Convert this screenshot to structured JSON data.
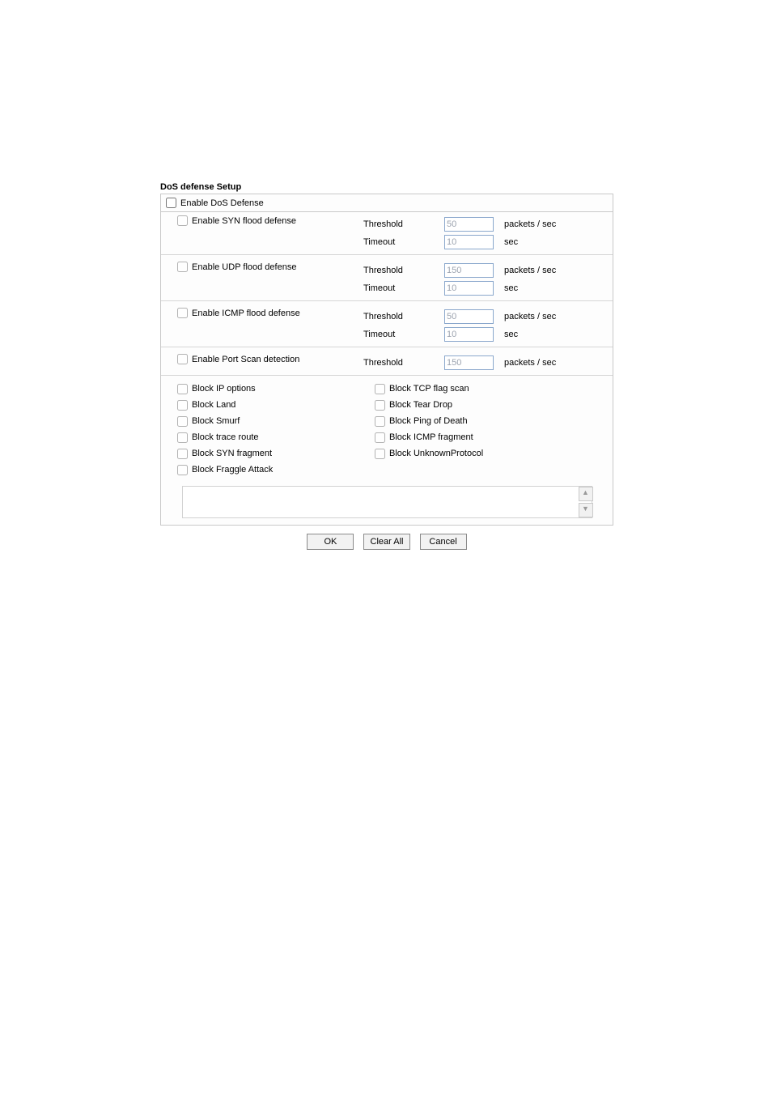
{
  "title": "DoS defense Setup",
  "enable_dos_label": "Enable DoS Defense",
  "flood_defs": [
    {
      "label": "Enable SYN flood defense",
      "lines": [
        {
          "label": "Threshold",
          "value": "50",
          "unit": "packets / sec"
        },
        {
          "label": "Timeout",
          "value": "10",
          "unit": "sec"
        }
      ]
    },
    {
      "label": "Enable UDP flood defense",
      "lines": [
        {
          "label": "Threshold",
          "value": "150",
          "unit": "packets / sec"
        },
        {
          "label": "Timeout",
          "value": "10",
          "unit": "sec"
        }
      ]
    },
    {
      "label": "Enable ICMP flood defense",
      "lines": [
        {
          "label": "Threshold",
          "value": "50",
          "unit": "packets / sec"
        },
        {
          "label": "Timeout",
          "value": "10",
          "unit": "sec"
        }
      ]
    }
  ],
  "portscan": {
    "label": "Enable Port Scan detection",
    "line": {
      "label": "Threshold",
      "value": "150",
      "unit": "packets / sec"
    }
  },
  "block_left": [
    "Block IP options",
    "Block Land",
    "Block Smurf",
    "Block trace route",
    "Block SYN fragment",
    "Block Fraggle Attack"
  ],
  "block_right": [
    "Block TCP flag scan",
    "Block Tear Drop",
    "Block Ping of Death",
    "Block ICMP fragment",
    "Block UnknownProtocol"
  ],
  "buttons": {
    "ok": "OK",
    "clear": "Clear All",
    "cancel": "Cancel"
  }
}
